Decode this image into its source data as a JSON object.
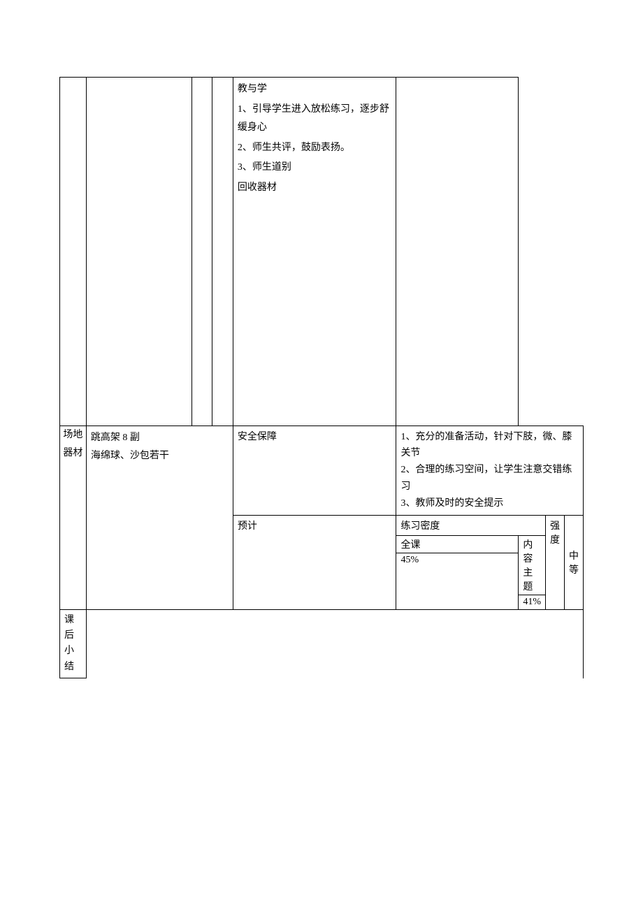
{
  "teaching": {
    "heading": "教与学",
    "item1": "1、引导学生进入放松练习，逐步舒缓身心",
    "item2": "2、师生共评，鼓励表扬。",
    "item3": "3、师生道别",
    "item4": "回收器材"
  },
  "equipment": {
    "venue_label": "场地",
    "equip_label": "器材",
    "venue_value": "跳高架 8 副",
    "equip_value": "海绵球、沙包若干"
  },
  "safety": {
    "label": "安全保障",
    "item1": "1、充分的准备活动，针对下肢，微、膝关节",
    "item2": "2、合理的练习空间，让学生注意交错练习",
    "item3": "3、教师及时的安全提示"
  },
  "prediction": {
    "label": "预计",
    "density_label": "练习密度",
    "intensity_label": "强度",
    "full_class_label": "全课",
    "content_theme_label": "内容主题",
    "full_class_value": "45%",
    "content_theme_value": "41%",
    "intensity_value": "中等"
  },
  "summary": {
    "label": "课后小结"
  }
}
